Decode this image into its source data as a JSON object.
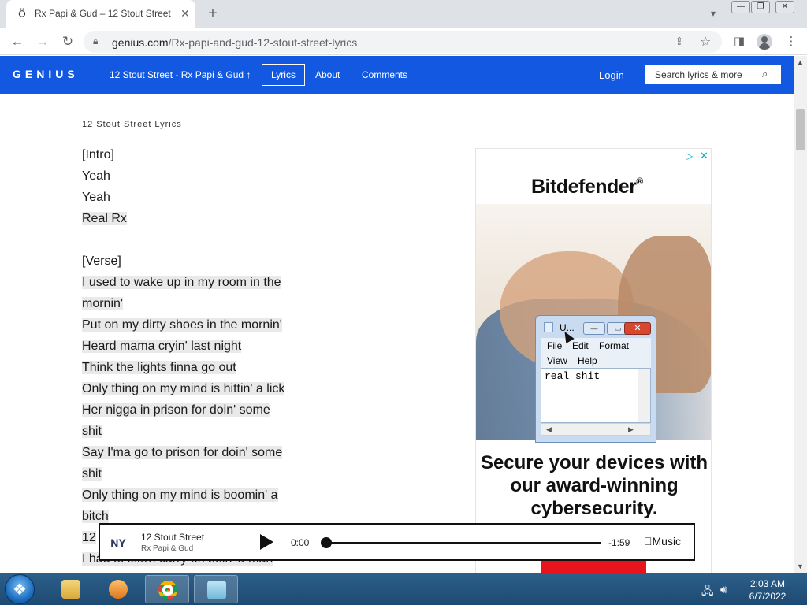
{
  "browser": {
    "tab_title": "Rx Papi & Gud – 12 Stout Street",
    "tab_close": "✕",
    "new_tab": "+",
    "url_domain": "genius.com",
    "url_path": "/Rx-papi-and-gud-12-stout-street-lyrics"
  },
  "genius": {
    "logo": "GENIUS",
    "song_link": "12 Stout Street - Rx Papi & Gud",
    "song_link_arrow": "↑",
    "nav": [
      "Lyrics",
      "About",
      "Comments"
    ],
    "login": "Login",
    "search_placeholder": "Search lyrics & more"
  },
  "lyrics": {
    "heading": "12 Stout Street Lyrics",
    "lines": [
      {
        "text": "[Intro]",
        "highlight": false
      },
      {
        "text": "Yeah",
        "highlight": false
      },
      {
        "text": "Yeah",
        "highlight": false
      },
      {
        "text": "Real Rx",
        "highlight": true
      },
      {
        "text": "",
        "highlight": false
      },
      {
        "text": "[Verse]",
        "highlight": false
      },
      {
        "text": "I used to wake up in my room in the",
        "highlight": true
      },
      {
        "text": "mornin'",
        "highlight": true
      },
      {
        "text": "Put on my dirty shoes in the mornin'",
        "highlight": true
      },
      {
        "text": "Heard mama cryin' last night",
        "highlight": true
      },
      {
        "text": "Think the lights finna go out",
        "highlight": true
      },
      {
        "text": "Only thing on my mind is hittin' a lick",
        "highlight": true
      },
      {
        "text": "Her nigga in prison for doin' some",
        "highlight": true
      },
      {
        "text": "shit",
        "highlight": true
      },
      {
        "text": "Say I'ma go to prison for doin' some",
        "highlight": true
      },
      {
        "text": "shit",
        "highlight": true
      },
      {
        "text": "Only thing on my mind is boomin' a",
        "highlight": true
      },
      {
        "text": "bitch",
        "highlight": true
      },
      {
        "text": "12",
        "highlight": true
      },
      {
        "text": "I had to learn carry on bein' a man",
        "highlight": true
      }
    ]
  },
  "ad": {
    "brand": "Bitdefender",
    "brand_mark": "®",
    "tagline": "Secure your devices with our award-winning cybersecurity."
  },
  "notepad": {
    "title": "U...",
    "menu": [
      "File",
      "Edit",
      "Format",
      "View",
      "Help"
    ],
    "content": "real shit"
  },
  "player": {
    "title": "12 Stout Street",
    "artist": "Rx Papi & Gud",
    "current_time": "0:00",
    "remaining_time": "-1:59",
    "brand": "Music",
    "progress": 0
  },
  "taskbar": {
    "time": "2:03 AM",
    "date": "6/7/2022"
  }
}
